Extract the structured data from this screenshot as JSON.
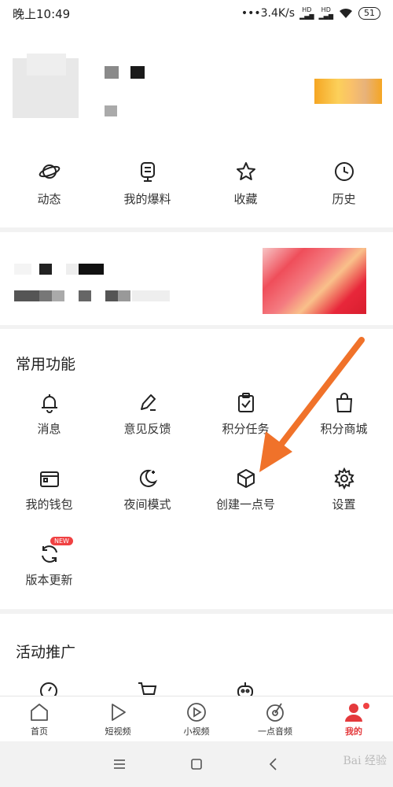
{
  "status_bar": {
    "time": "晚上10:49",
    "network_speed": "3.4K/s",
    "sig1": "HD",
    "sig2": "HD",
    "battery": "51"
  },
  "quick_actions": [
    {
      "label": "动态",
      "icon": "planet-icon"
    },
    {
      "label": "我的爆料",
      "icon": "tip-icon"
    },
    {
      "label": "收藏",
      "icon": "star-icon"
    },
    {
      "label": "历史",
      "icon": "clock-icon"
    }
  ],
  "common_functions": {
    "title": "常用功能",
    "items": [
      {
        "label": "消息",
        "icon": "bell-icon"
      },
      {
        "label": "意见反馈",
        "icon": "pen-icon"
      },
      {
        "label": "积分任务",
        "icon": "clipboard-check-icon"
      },
      {
        "label": "积分商城",
        "icon": "shopping-bag-icon"
      },
      {
        "label": "我的钱包",
        "icon": "wallet-icon"
      },
      {
        "label": "夜间模式",
        "icon": "moon-icon"
      },
      {
        "label": "创建一点号",
        "icon": "cube-icon"
      },
      {
        "label": "设置",
        "icon": "gear-icon"
      },
      {
        "label": "版本更新",
        "icon": "refresh-icon",
        "badge": "NEW"
      }
    ]
  },
  "promotions": {
    "title": "活动推广"
  },
  "tab_bar": [
    {
      "label": "首页",
      "icon": "home-icon"
    },
    {
      "label": "短视频",
      "icon": "play-icon"
    },
    {
      "label": "小视频",
      "icon": "circle-play-icon"
    },
    {
      "label": "一点音频",
      "icon": "audio-icon"
    },
    {
      "label": "我的",
      "icon": "user-icon",
      "active": true
    }
  ],
  "watermark": "Bai 经验",
  "colors": {
    "accent": "#e4393c",
    "annotation_arrow": "#f0722a",
    "badge": "#f04142"
  }
}
